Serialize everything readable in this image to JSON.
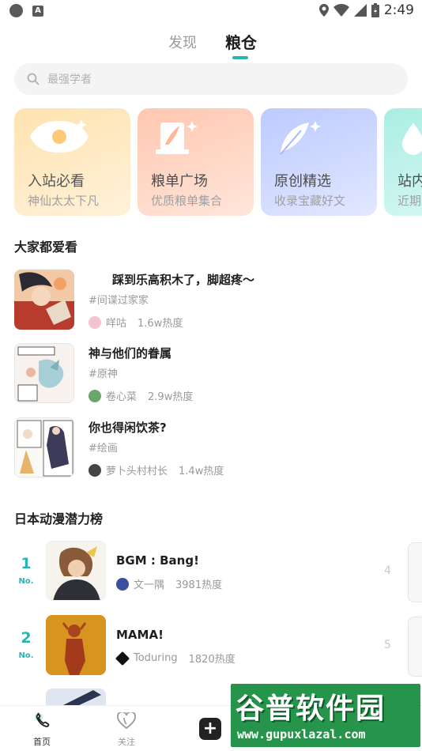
{
  "status_bar": {
    "time": "2:49",
    "app_badge": "A"
  },
  "top_tabs": [
    {
      "label": "发现",
      "active": false
    },
    {
      "label": "粮仓",
      "active": true
    }
  ],
  "search": {
    "placeholder": "最强学者"
  },
  "categories": [
    {
      "title": "入站必看",
      "subtitle": "神仙太太下凡",
      "icon": "eye-icon"
    },
    {
      "title": "粮单广场",
      "subtitle": "优质粮单集合",
      "icon": "book-icon"
    },
    {
      "title": "原创精选",
      "subtitle": "收录宝藏好文",
      "icon": "feather-icon"
    },
    {
      "title": "站内",
      "subtitle": "近期",
      "icon": "drop-icon"
    }
  ],
  "popular": {
    "heading": "大家都爱看",
    "items": [
      {
        "title": "踩到乐高积木了，脚超疼～",
        "tag": "#间谍过家家",
        "author": "咩咕",
        "heat": "1.6w热度"
      },
      {
        "title": "神与他们的眷属",
        "tag": "#原神",
        "author": "卷心菜",
        "heat": "2.9w热度"
      },
      {
        "title": "你也得闲饮茶?",
        "tag": "#绘画",
        "author": "萝卜头村村长",
        "heat": "1.4w热度"
      }
    ]
  },
  "ranking": {
    "heading": "日本动漫潜力榜",
    "no_label": "No.",
    "items": [
      {
        "rank": "1",
        "title": "BGM : Bang!",
        "author": "文一隅",
        "heat": "3981热度"
      },
      {
        "rank": "2",
        "title": "MAMA!",
        "author": "Toduring",
        "heat": "1820热度"
      }
    ],
    "right_column": [
      {
        "rank": "4"
      },
      {
        "rank": "5"
      }
    ]
  },
  "bottom_nav": [
    {
      "label": "首页",
      "icon": "home-icon",
      "active": true
    },
    {
      "label": "关注",
      "icon": "heart-icon",
      "active": false
    },
    {
      "label": "",
      "icon": "plus-icon",
      "active": false
    }
  ],
  "watermark": {
    "text": "谷普软件园",
    "url": "www.gupuxlazal.com"
  },
  "colors": {
    "accent": "#26b7b4",
    "text_primary": "#1f1f1f",
    "text_secondary": "#999999"
  }
}
